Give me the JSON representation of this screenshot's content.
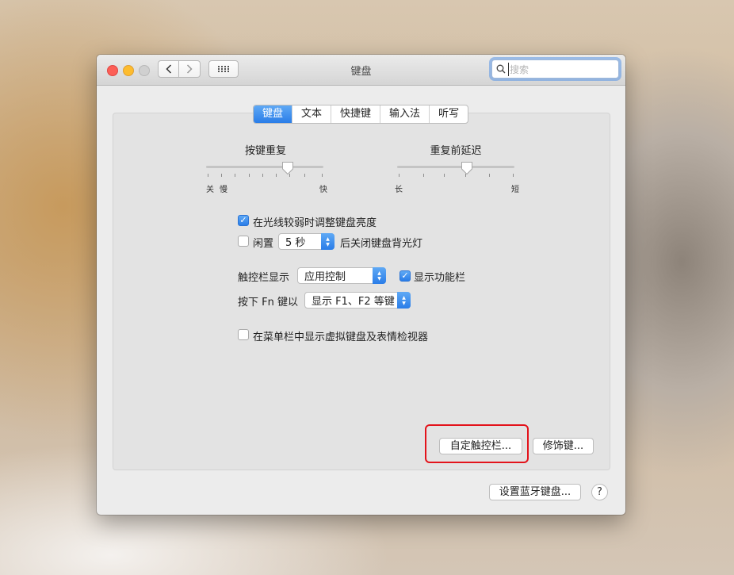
{
  "window": {
    "title": "键盘",
    "search_placeholder": "搜索"
  },
  "tabs": [
    {
      "label": "键盘",
      "active": true
    },
    {
      "label": "文本",
      "active": false
    },
    {
      "label": "快捷键",
      "active": false
    },
    {
      "label": "输入法",
      "active": false
    },
    {
      "label": "听写",
      "active": false
    }
  ],
  "sliders": {
    "key_repeat": {
      "label": "按键重复",
      "min_label1": "关",
      "min_label2": "慢",
      "max_label": "快",
      "value": 0.7
    },
    "delay_until_repeat": {
      "label": "重复前延迟",
      "min_label": "长",
      "max_label": "短",
      "value": 0.6
    }
  },
  "options": {
    "adjust_brightness": {
      "label": "在光线较弱时调整键盘亮度",
      "checked": true
    },
    "idle_backlight": {
      "label_before": "闲置",
      "value": "5 秒",
      "label_after": "后关闭键盘背光灯",
      "checked": false
    },
    "touchbar_display": {
      "label": "触控栏显示",
      "value": "应用控制"
    },
    "show_control_strip": {
      "label": "显示功能栏",
      "checked": true
    },
    "fn_key": {
      "label": "按下 Fn 键以",
      "value": "显示 F1、F2 等键"
    },
    "show_keyboard_viewer": {
      "label": "在菜单栏中显示虚拟键盘及表情检视器",
      "checked": false
    }
  },
  "buttons": {
    "customize_touchbar": "自定触控栏...",
    "modifier_keys": "修饰键...",
    "bluetooth_keyboard": "设置蓝牙键盘...",
    "help": "?"
  },
  "colors": {
    "accent": "#2a7de8",
    "highlight": "#e3131b"
  }
}
